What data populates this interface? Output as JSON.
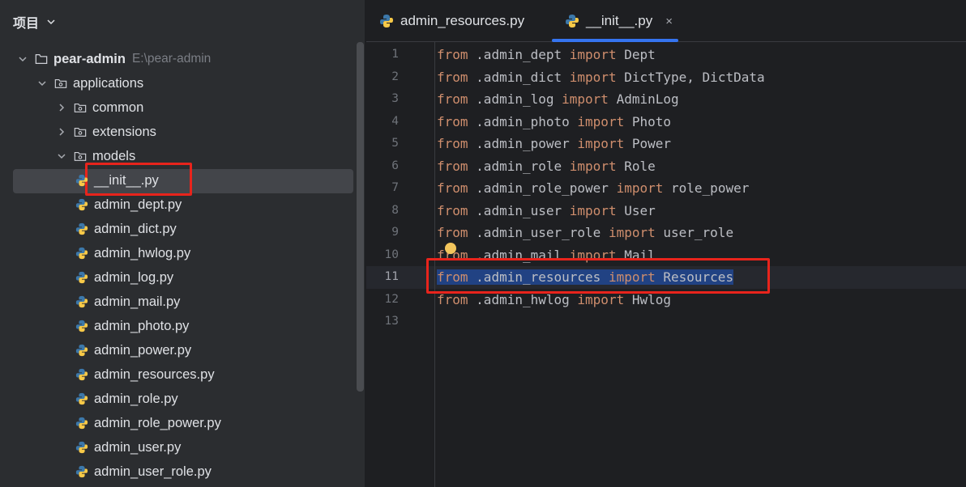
{
  "project": {
    "header_label": "项目",
    "tree": [
      {
        "label": "pear-admin",
        "path": "E:\\pear-admin",
        "type": "folder",
        "arrow": "down",
        "level": 0,
        "bold": true
      },
      {
        "label": "applications",
        "type": "package",
        "arrow": "down",
        "level": 1
      },
      {
        "label": "common",
        "type": "package",
        "arrow": "right",
        "level": 2
      },
      {
        "label": "extensions",
        "type": "package",
        "arrow": "right",
        "level": 2
      },
      {
        "label": "models",
        "type": "package",
        "arrow": "down",
        "level": 2
      },
      {
        "label": "__init__.py",
        "type": "python",
        "level": 3,
        "selected": true
      },
      {
        "label": "admin_dept.py",
        "type": "python",
        "level": 3
      },
      {
        "label": "admin_dict.py",
        "type": "python",
        "level": 3
      },
      {
        "label": "admin_hwlog.py",
        "type": "python",
        "level": 3
      },
      {
        "label": "admin_log.py",
        "type": "python",
        "level": 3
      },
      {
        "label": "admin_mail.py",
        "type": "python",
        "level": 3
      },
      {
        "label": "admin_photo.py",
        "type": "python",
        "level": 3
      },
      {
        "label": "admin_power.py",
        "type": "python",
        "level": 3
      },
      {
        "label": "admin_resources.py",
        "type": "python",
        "level": 3
      },
      {
        "label": "admin_role.py",
        "type": "python",
        "level": 3
      },
      {
        "label": "admin_role_power.py",
        "type": "python",
        "level": 3
      },
      {
        "label": "admin_user.py",
        "type": "python",
        "level": 3
      },
      {
        "label": "admin_user_role.py",
        "type": "python",
        "level": 3
      }
    ]
  },
  "tabs": [
    {
      "label": "admin_resources.py",
      "active": false
    },
    {
      "label": "__init__.py",
      "active": true,
      "close": "×"
    }
  ],
  "editor": {
    "current_line": 11,
    "lines": [
      {
        "num": "1",
        "module": ".admin_dept",
        "names": "Dept"
      },
      {
        "num": "2",
        "module": ".admin_dict",
        "names": "DictType, DictData"
      },
      {
        "num": "3",
        "module": ".admin_log",
        "names": "AdminLog"
      },
      {
        "num": "4",
        "module": ".admin_photo",
        "names": "Photo"
      },
      {
        "num": "5",
        "module": ".admin_power",
        "names": "Power"
      },
      {
        "num": "6",
        "module": ".admin_role",
        "names": "Role"
      },
      {
        "num": "7",
        "module": ".admin_role_power",
        "names": "role_power"
      },
      {
        "num": "8",
        "module": ".admin_user",
        "names": "User"
      },
      {
        "num": "9",
        "module": ".admin_user_role",
        "names": "user_role"
      },
      {
        "num": "10",
        "module": ".admin_mail",
        "names": "Mail"
      },
      {
        "num": "11",
        "module": ".admin_resources",
        "names": "Resources",
        "selected": true
      },
      {
        "num": "12",
        "module": ".admin_hwlog",
        "names": "Hwlog"
      },
      {
        "num": "13",
        "module": "",
        "names": ""
      }
    ],
    "keywords": {
      "from": "from",
      "import": "import"
    }
  },
  "colors": {
    "keyword": "#cf8e6d",
    "selection": "#214283",
    "annotation": "#e8241c",
    "accent": "#3574f0"
  }
}
